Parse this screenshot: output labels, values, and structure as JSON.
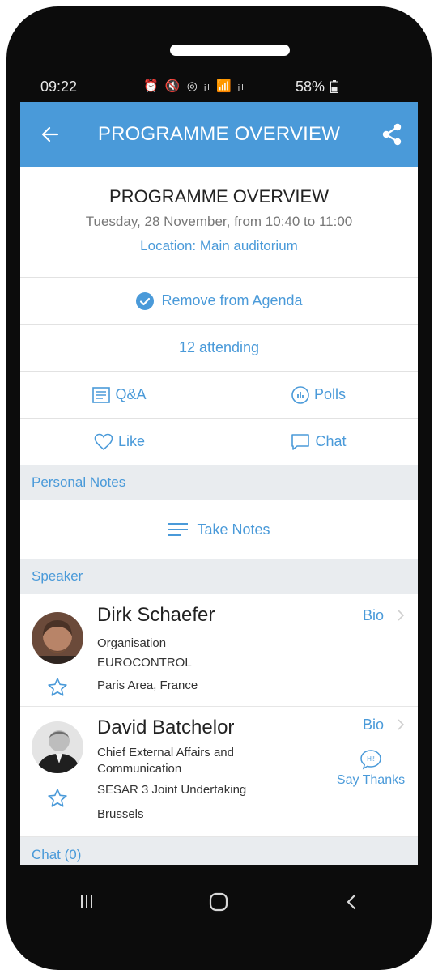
{
  "status_bar": {
    "time": "09:22",
    "icons": "⏰ 🔇 ◎ ᵢₗ 📶 ᵢₗ",
    "battery": "58%"
  },
  "app_bar": {
    "title": "PROGRAMME OVERVIEW",
    "back_icon": "arrow-left-icon",
    "share_icon": "share-icon",
    "color": "#4a9ad9"
  },
  "session": {
    "title": "PROGRAMME OVERVIEW",
    "datetime": "Tuesday, 28 November, from 10:40 to 11:00",
    "location": "Location: Main auditorium"
  },
  "actions": {
    "agenda_label": "Remove from Agenda",
    "attending_label": "12 attending",
    "qa_label": "Q&A",
    "polls_label": "Polls",
    "like_label": "Like",
    "chat_label": "Chat"
  },
  "personal_notes": {
    "header": "Personal Notes",
    "take_notes_label": "Take Notes"
  },
  "speaker_section": {
    "header": "Speaker",
    "speakers": [
      {
        "name": "Dirk Schaefer",
        "line1": "Organisation",
        "line2": "EUROCONTROL",
        "line3": "Paris Area, France",
        "bio_label": "Bio"
      },
      {
        "name": "David Batchelor",
        "line1": "Chief External Affairs and",
        "line2": "Communication",
        "line3": "SESAR 3 Joint Undertaking",
        "line4": "Brussels",
        "bio_label": "Bio",
        "thanks_label": "Say Thanks"
      }
    ]
  },
  "chat_section": {
    "header": "Chat (0)"
  },
  "nav_bar": {
    "recent_icon": "recent-apps-icon",
    "home_icon": "home-icon",
    "back_icon": "back-chevron-icon"
  }
}
